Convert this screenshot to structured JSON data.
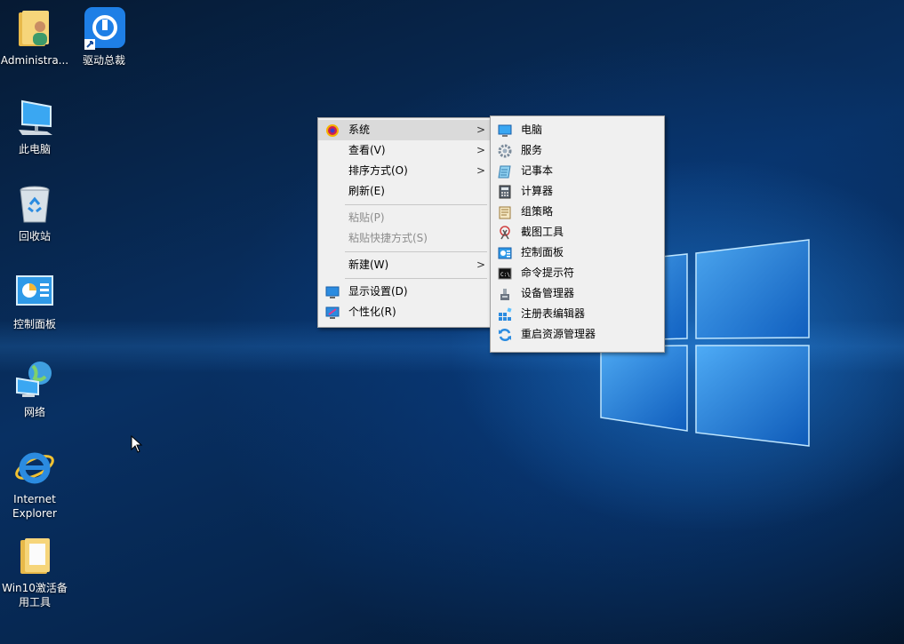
{
  "desktop": {
    "icons": [
      {
        "label": "Administra...",
        "icon": "user-folder-icon"
      },
      {
        "label": "驱动总裁",
        "icon": "driver-tool-icon"
      },
      {
        "label": "此电脑",
        "icon": "computer-icon"
      },
      {
        "label": "回收站",
        "icon": "recycle-bin-icon"
      },
      {
        "label": "控制面板",
        "icon": "control-panel-icon"
      },
      {
        "label": "网络",
        "icon": "network-icon"
      },
      {
        "label": "Internet\nExplorer",
        "icon": "internet-explorer-icon"
      },
      {
        "label": "Win10激活备\n用工具",
        "icon": "folder-icon"
      }
    ]
  },
  "context_menu": {
    "items": [
      {
        "label": "系统",
        "icon": "system-icon",
        "submenu": true,
        "highlighted": true
      },
      {
        "label": "查看(V)",
        "submenu": true
      },
      {
        "label": "排序方式(O)",
        "submenu": true
      },
      {
        "label": "刷新(E)"
      },
      {
        "label": "粘贴(P)",
        "disabled": true
      },
      {
        "label": "粘贴快捷方式(S)",
        "disabled": true
      },
      {
        "label": "新建(W)",
        "submenu": true
      },
      {
        "label": "显示设置(D)",
        "icon": "display-settings-icon"
      },
      {
        "label": "个性化(R)",
        "icon": "personalize-icon"
      }
    ]
  },
  "submenu": {
    "items": [
      {
        "label": "电脑",
        "icon": "monitor-icon"
      },
      {
        "label": "服务",
        "icon": "services-gear-icon"
      },
      {
        "label": "记事本",
        "icon": "notepad-icon"
      },
      {
        "label": "计算器",
        "icon": "calculator-icon"
      },
      {
        "label": "组策略",
        "icon": "group-policy-icon"
      },
      {
        "label": "截图工具",
        "icon": "snipping-tool-icon"
      },
      {
        "label": "控制面板",
        "icon": "control-panel-icon"
      },
      {
        "label": "命令提示符",
        "icon": "command-prompt-icon"
      },
      {
        "label": "设备管理器",
        "icon": "device-manager-icon"
      },
      {
        "label": "注册表编辑器",
        "icon": "registry-editor-icon"
      },
      {
        "label": "重启资源管理器",
        "icon": "restart-explorer-icon"
      }
    ]
  },
  "colors": {
    "desktop_dark": "#061a33",
    "desktop_glow": "#2a8ce6",
    "menu_bg": "#f0f0f0",
    "menu_highlight": "#dadada",
    "menu_disabled_text": "#8d8d8d"
  }
}
